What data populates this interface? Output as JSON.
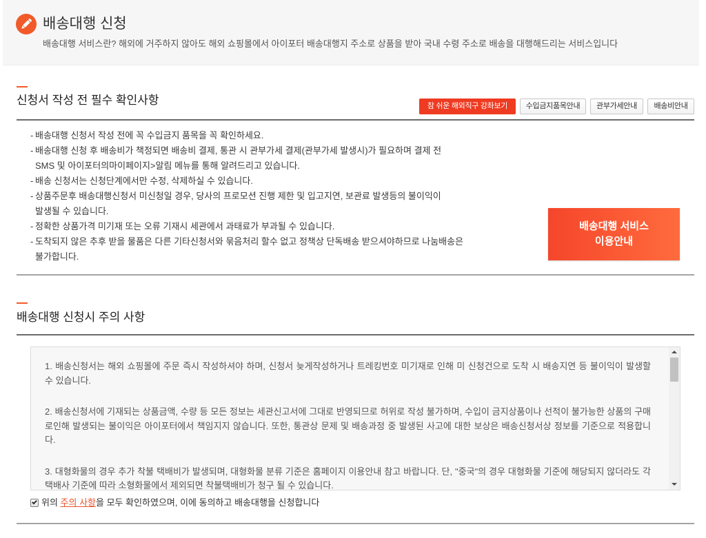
{
  "page": {
    "title": "배송대행 신청",
    "subtitle": "배송대행 서비스란? 해외에 거주하지 않아도 해외 쇼핑몰에서 아이포터 배송대행지 주소로 상품을 받아 국내 수령 주소로 배송을 대행해드리는 서비스입니다"
  },
  "checklist_section": {
    "heading": "신청서 작성 전 필수 확인사항",
    "buttons": [
      {
        "label": "참 쉬운 해외직구 강좌보기",
        "highlighted": true
      },
      {
        "label": "수입금지품목안내",
        "highlighted": false
      },
      {
        "label": "관부가세안내",
        "highlighted": false
      },
      {
        "label": "배송비안내",
        "highlighted": false
      }
    ],
    "bullet": "-",
    "items": [
      "배송대행 신청서 작성 전에 꼭 수입금지 품목을 꼭 확인하세요.",
      "배송대행 신청 후 배송비가 책정되면 배송비 결제, 통관 시 관부가세 결제(관부가세 발생시)가 필요하며 결제 전\nSMS 및 아이포터의마이페이지>알림 메뉴를 통해 알려드리고 있습니다.",
      "배송 신청서는 신청단계에서만 수정, 삭제하실 수 있습니다.",
      "상품주문후 배송대행신청서 미신청일 경우, 당사의 프로모션 진행 제한 및 입고지연, 보관료 발생등의 불이익이\n발생될 수 있습니다.",
      "정확한 상품가격 미기재 또는 오류 기재시 세관에서 과태료가 부과될 수 있습니다.",
      "도착되지 않은 추후 받을 물품은 다른 기타신청서와 묶음처리 할수 없고 정책상 단독배송 받으셔야하므로 나눔배송은\n불가합니다."
    ],
    "guide_button": {
      "line1": "배송대행 서비스",
      "line2": "이용안내"
    }
  },
  "notice_section": {
    "heading": "배송대행 신청시 주의 사항",
    "paragraphs": [
      "1. 배송신청서는 해외 쇼핑몰에 주문 즉시 작성하셔야 하며, 신청서 늦게작성하거나 트레킹번호 미기재로 인해 미 신청건으로 도착 시 배송지연 등 불이익이 발생할 수 있습니다.",
      "2. 배송신청서에 기재되는 상품금액, 수량 등 모든 정보는 세관신고서에 그대로 반영되므로 허위로 작성 불가하며, 수입이 금지상품이나 선적이 불가능한 상품의 구매로인해 발생되는 불이익은 아이포터에서 책임지지 않습니다. 또한, 통관상 문제 및 배송과정 중 발생된 사고에 대한 보상은 배송신청서상 정보를 기준으로 적용합니다.",
      "3. 대형화물의 경우 추가 착불 택배비가 발생되며, 대형화물 분류 기준은 홈페이지 이용안내 참고 바랍니다. 단, \"중국\"의 경우 대형화물 기준에 해당되지 않더라도 각 택배사 기준에 따라 소형화물에서 제외되면 착불택배비가 청구 될 수 있습니다."
    ]
  },
  "agreement": {
    "checked": true,
    "text_before": "위의 ",
    "link_text": "주의 사항",
    "text_after": "을 모두 확인하였으며, 이에 동의하고 배송대행을 신청합니다"
  },
  "icons": {
    "title": "pencil-icon",
    "checkbox": "checkmark-icon",
    "scroll_up": "arrow-up-icon",
    "scroll_down": "arrow-down-icon"
  },
  "colors": {
    "accent": "#f15a29",
    "highlight_button": "#ee3b22",
    "guide_button_start": "#f5462b",
    "guide_button_end": "#ff6b3d",
    "link": "#e8542c"
  }
}
